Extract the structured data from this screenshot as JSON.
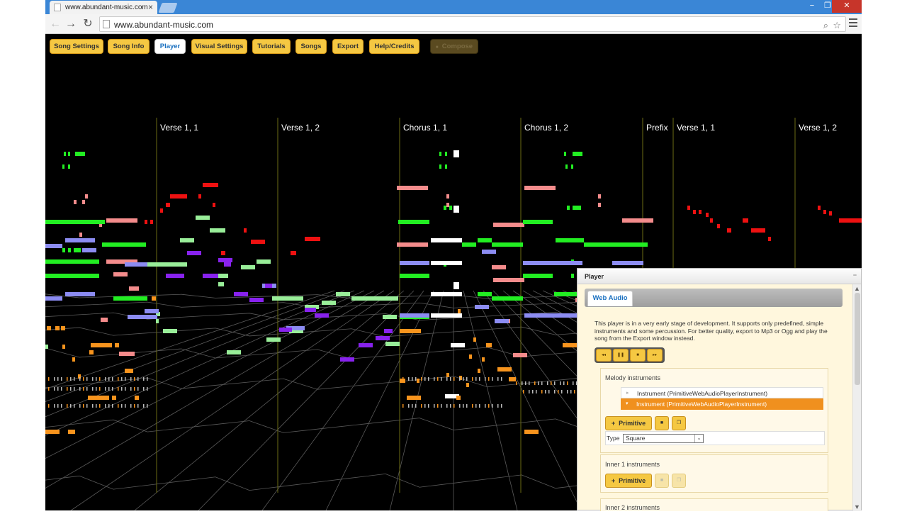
{
  "browser": {
    "tab_title": "www.abundant-music.com",
    "tab_close": "×",
    "url": "www.abundant-music.com",
    "window_controls": [
      "−",
      "❐",
      "✕"
    ]
  },
  "app_buttons": [
    {
      "label": "Song Settings",
      "state": "normal"
    },
    {
      "label": "Song Info",
      "state": "normal"
    },
    {
      "label": "Player",
      "state": "active"
    },
    {
      "label": "Visual Settings",
      "state": "normal"
    },
    {
      "label": "Tutorials",
      "state": "normal"
    },
    {
      "label": "Songs",
      "state": "normal"
    },
    {
      "label": "Export",
      "state": "normal"
    },
    {
      "label": "Help/Credits",
      "state": "normal"
    },
    {
      "label": "Compose",
      "state": "disabled"
    }
  ],
  "sections": [
    {
      "label": "Verse 1, 1"
    },
    {
      "label": "Verse 1, 2"
    },
    {
      "label": "Chorus 1, 1"
    },
    {
      "label": "Chorus 1, 2"
    },
    {
      "label": "Prefix"
    },
    {
      "label": "Verse 1, 1"
    },
    {
      "label": "Verse 1, 2"
    }
  ],
  "colors": {
    "melody_green": "#22ee22",
    "bass_blue": "#8c8cf2",
    "pink": "#f48c8c",
    "red": "#ee1111",
    "orange": "#f7941d",
    "purple": "#8822ee",
    "light_green": "#99ee99",
    "white": "#ffffff",
    "section_line": "#6b6b15",
    "accent_button": "#f5c842"
  },
  "player": {
    "title": "Player",
    "tab": "Web Audio",
    "description": "This player is in a very early stage of development. It supports only predefined, simple instruments and some percussion. For better quality, export to Mp3 or Ogg and play the song from the Export window instead.",
    "transport_icons": [
      "rewind-icon",
      "pause-icon",
      "stop-icon",
      "forward-icon"
    ],
    "transport_glyphs": [
      "◂◂",
      "❚❚",
      "■",
      "▸▸"
    ],
    "melody": {
      "title": "Melody instruments",
      "instruments": [
        {
          "label": "Instrument (PrimitiveWebAudioPlayerInstrument)",
          "selected": false
        },
        {
          "label": "Instrument (PrimitiveWebAudioPlayerInstrument)",
          "selected": true
        }
      ],
      "add_label": "Primitive",
      "type_label": "Type",
      "type_value": "Square"
    },
    "inner1": {
      "title": "Inner 1 instruments",
      "add_label": "Primitive"
    },
    "inner2": {
      "title": "Inner 2 instruments"
    }
  }
}
